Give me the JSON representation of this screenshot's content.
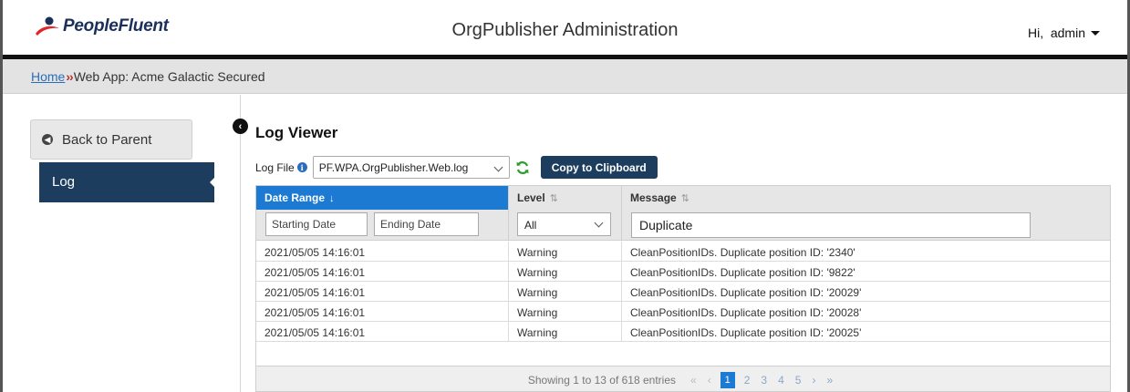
{
  "header": {
    "logo_text": "PeopleFluent",
    "app_title": "OrgPublisher Administration",
    "user_greeting": "Hi,  admin",
    "brand_color": "#1a2f5a",
    "logo_accent": "#e0252b"
  },
  "breadcrumb": {
    "home_label": "Home",
    "separator": "››",
    "current_label": "Web App: Acme Galactic Secured"
  },
  "sidebar": {
    "back_label": "Back to Parent",
    "active_item": "Log"
  },
  "main": {
    "title": "Log Viewer",
    "log_file_label": "Log File",
    "log_file_value": "PF.WPA.OrgPublisher.Web.log",
    "copy_button": "Copy to Clipboard"
  },
  "table": {
    "columns": {
      "date": "Date Range",
      "date_sort": "↓",
      "level": "Level",
      "level_sort": "⇅",
      "message": "Message",
      "message_sort": "⇅"
    },
    "filters": {
      "start_placeholder": "Starting Date",
      "end_placeholder": "Ending Date",
      "level_value": "All",
      "message_value": "Duplicate"
    },
    "rows": [
      {
        "date": "2021/05/05 14:16:01",
        "level": "Warning",
        "message": "CleanPositionIDs. Duplicate position ID: '2340'"
      },
      {
        "date": "2021/05/05 14:16:01",
        "level": "Warning",
        "message": "CleanPositionIDs. Duplicate position ID: '9822'"
      },
      {
        "date": "2021/05/05 14:16:01",
        "level": "Warning",
        "message": "CleanPositionIDs. Duplicate position ID: '20029'"
      },
      {
        "date": "2021/05/05 14:16:01",
        "level": "Warning",
        "message": "CleanPositionIDs. Duplicate position ID: '20028'"
      },
      {
        "date": "2021/05/05 14:16:01",
        "level": "Warning",
        "message": "CleanPositionIDs. Duplicate position ID: '20025'"
      }
    ],
    "pager": {
      "info": "Showing 1 to 13 of 618 entries",
      "first": "«",
      "prev": "‹",
      "pages": [
        "1",
        "2",
        "3",
        "4",
        "5"
      ],
      "active_page": "1",
      "next": "›",
      "last": "»"
    }
  }
}
